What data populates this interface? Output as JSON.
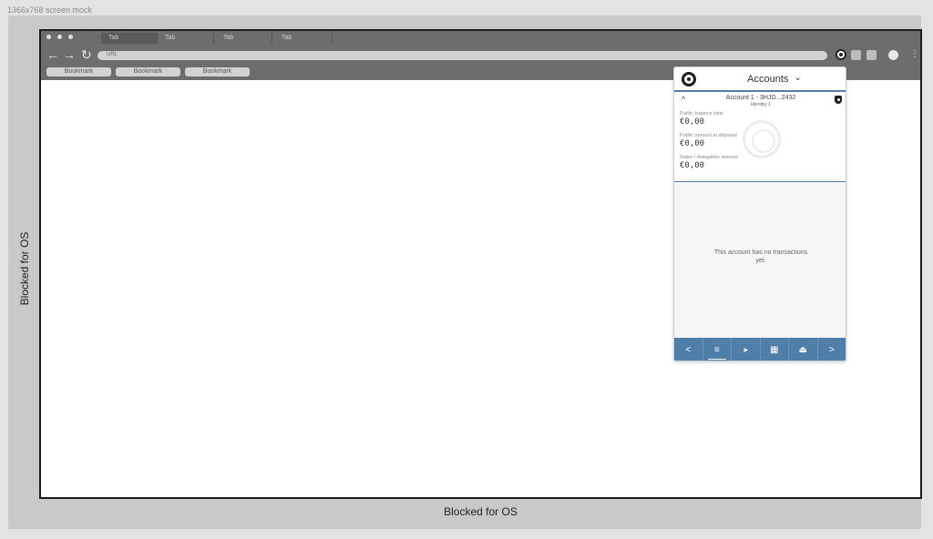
{
  "mock_label": "1366x768 screen mock",
  "os": {
    "left_label": "Blocked for OS",
    "bottom_label": "Blocked for OS"
  },
  "browser": {
    "tabs": [
      "Tab",
      "Tab",
      "Tab",
      "Tab"
    ],
    "url_placeholder": "URL",
    "bookmarks": [
      "Bookmark",
      "Bookmark",
      "Bookmark"
    ],
    "icons": {
      "back": "←",
      "forward": "→",
      "reload": "↻",
      "menu": "⋮"
    }
  },
  "popup": {
    "title": "Accounts",
    "title_caret": "⌄",
    "account": {
      "collapse_icon": "^",
      "name": "Account 1 - 3HJG...2432",
      "identity": "Identity 1",
      "balances": [
        {
          "label": "Public balance total",
          "value": "€0,00"
        },
        {
          "label": "Public amount  at disposal",
          "value": "€0,00"
        },
        {
          "label": "Stake / delegation amount",
          "value": "€0,00"
        }
      ]
    },
    "empty_text": "This account has no transactions yet.",
    "footer": {
      "prev": "<",
      "list": "≡",
      "send": "➤",
      "qr": "▦",
      "bake": "⏏",
      "next": ">"
    }
  },
  "colors": {
    "accent": "#4f7ea8",
    "chrome": "#6d6d6d",
    "os_area": "#c9c9c9"
  }
}
